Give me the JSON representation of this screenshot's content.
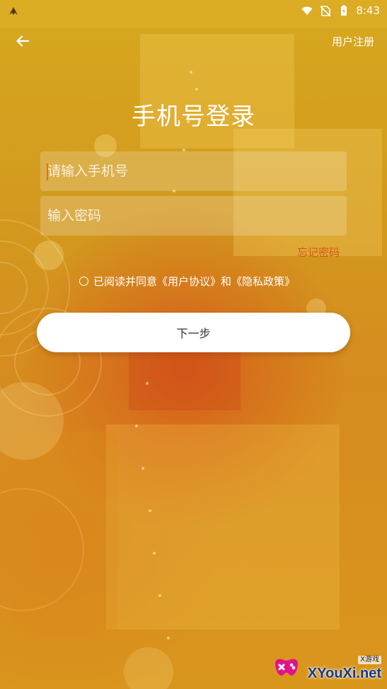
{
  "status_bar": {
    "time": "8:43",
    "icons": [
      "notification-app-icon",
      "wifi-icon",
      "no-sim-icon",
      "battery-icon"
    ]
  },
  "header": {
    "back_icon": "arrow-left-icon",
    "register_label": "用户注册"
  },
  "main": {
    "title": "手机号登录",
    "phone_input": {
      "placeholder": "请输入手机号",
      "value": ""
    },
    "password_input": {
      "placeholder": "输入密码",
      "value": ""
    },
    "forgot_password_label": "忘记密码",
    "agreement": {
      "prefix": "已阅读并同意",
      "user_agreement": "《用户协议》",
      "joiner": "和",
      "privacy_policy": "《隐私政策》",
      "checked": false
    },
    "next_button_label": "下一步"
  },
  "watermark": {
    "small_text": "X游戏",
    "text": "XYouXi.net"
  },
  "colors": {
    "background": "#d89a1c",
    "forgot_password": "#d24a12",
    "button_background": "#ffffff",
    "text_light": "#ffffff"
  }
}
